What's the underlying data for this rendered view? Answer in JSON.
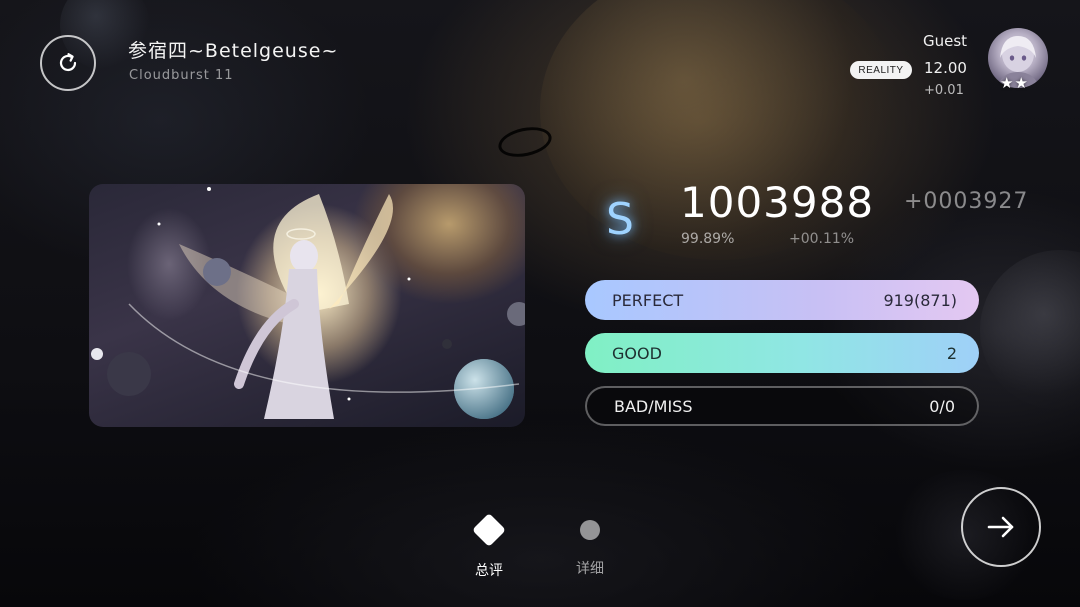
{
  "song": {
    "title": "参宿四~Betelgeuse~",
    "level": "Cloudburst 11"
  },
  "player": {
    "mode_badge": "REALITY",
    "name": "Guest",
    "rks": "12.00",
    "rks_delta": "+0.01",
    "avatar_stars": "★★"
  },
  "result": {
    "grade": "S",
    "score": "1003988",
    "score_delta": "+0003927",
    "accuracy": "99.89%",
    "accuracy_delta": "+00.11%"
  },
  "judgements": [
    {
      "label": "PERFECT",
      "value": "919(871)"
    },
    {
      "label": "GOOD",
      "value": "2"
    },
    {
      "label": "BAD/MISS",
      "value": "0/0"
    }
  ],
  "tabs": [
    {
      "label": "总评",
      "active": true
    },
    {
      "label": "详细",
      "active": false
    }
  ],
  "colors": {
    "grade_glow": "#9fd3ff",
    "perfect_bar": "#a8c8ff",
    "good_bar": "#80f0c4"
  },
  "icons": {
    "retry": "retry-icon",
    "next": "arrow-right-icon"
  }
}
